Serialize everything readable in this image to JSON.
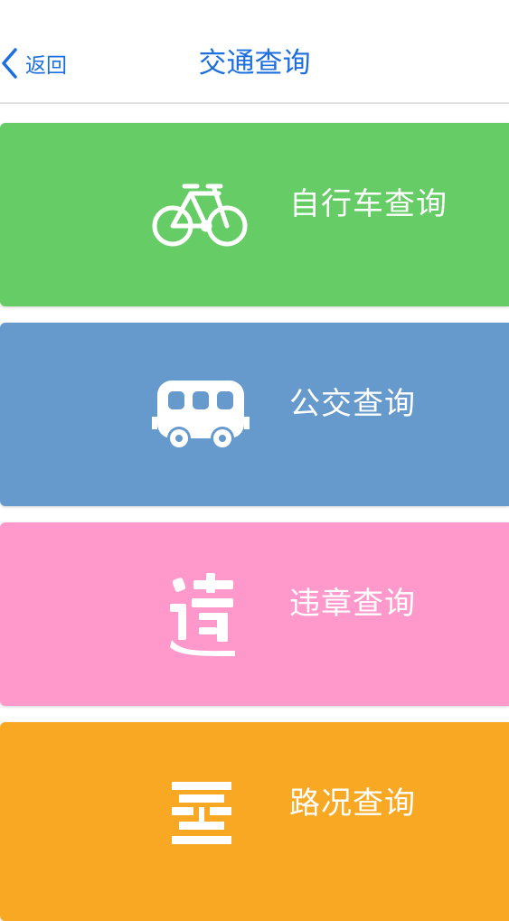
{
  "nav": {
    "back_label": "返回",
    "title": "交通查询"
  },
  "menu": {
    "items": [
      {
        "label": "自行车查询",
        "color": "#66cc66",
        "icon": "bicycle-icon"
      },
      {
        "label": "公交查询",
        "color": "#6699cc",
        "icon": "bus-icon"
      },
      {
        "label": "违章查询",
        "color": "#ff99cc",
        "icon": "violation-icon"
      },
      {
        "label": "路况查询",
        "color": "#f9a824",
        "icon": "road-condition-icon"
      }
    ]
  },
  "colors": {
    "accent": "#1d6fe0",
    "divider": "#e2e2e2"
  }
}
